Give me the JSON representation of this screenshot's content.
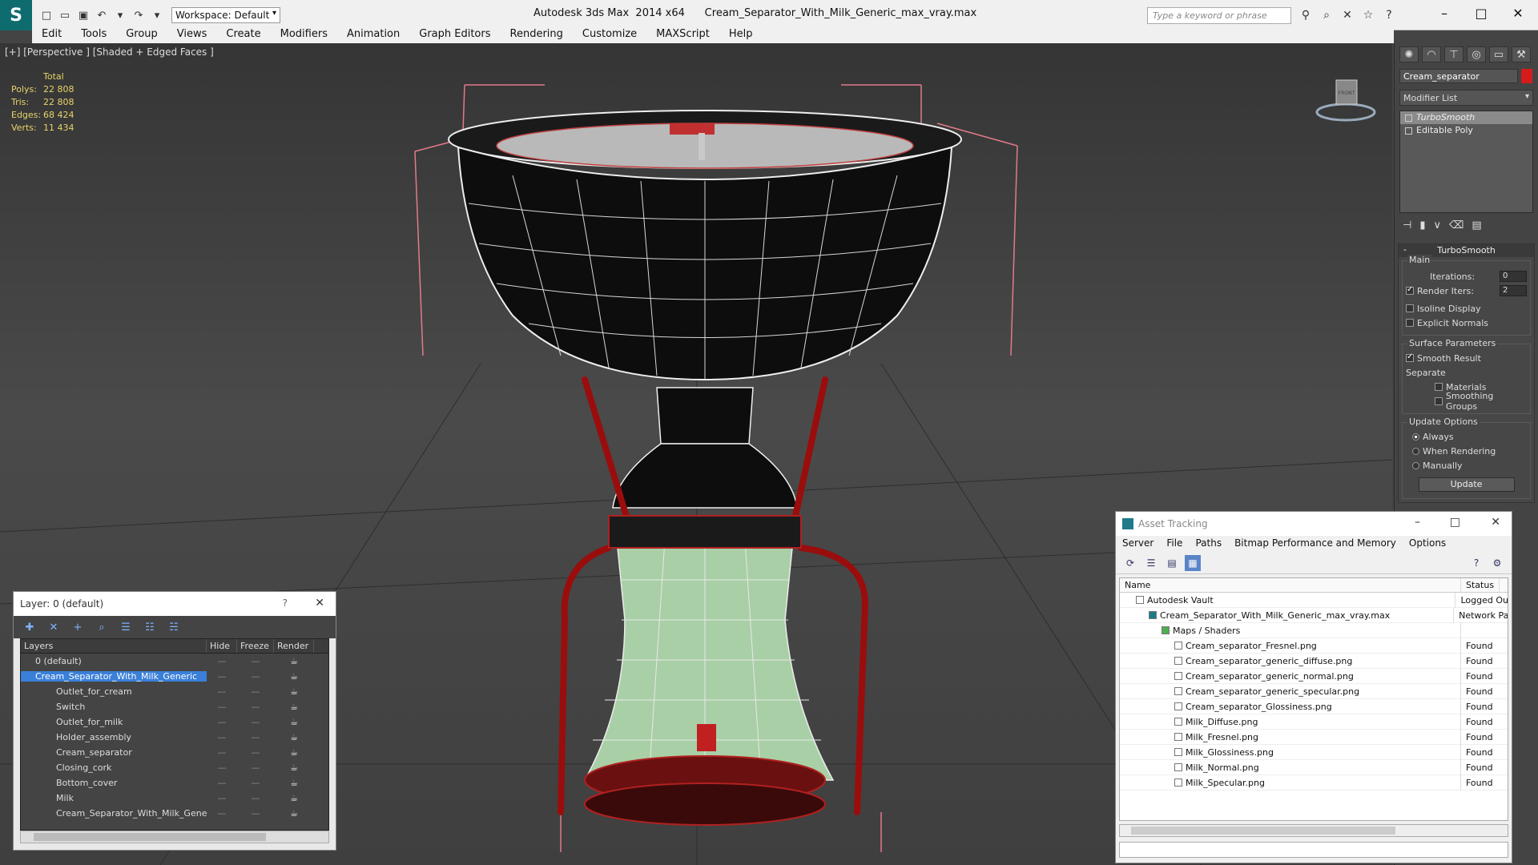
{
  "window": {
    "title": "Autodesk 3ds Max  2014 x64      Cream_Separator_With_Milk_Generic_max_vray.max",
    "workspace": "Workspace: Default",
    "search_placeholder": "Type a keyword or phrase"
  },
  "menu": [
    "Edit",
    "Tools",
    "Group",
    "Views",
    "Create",
    "Modifiers",
    "Animation",
    "Graph Editors",
    "Rendering",
    "Customize",
    "MAXScript",
    "Help"
  ],
  "viewport": {
    "label": "[+] [Perspective ] [Shaded + Edged Faces ]",
    "stats": {
      "header": "Total",
      "rows": [
        {
          "k": "Polys:",
          "v": "22 808"
        },
        {
          "k": "Tris:",
          "v": "22 808"
        },
        {
          "k": "Edges:",
          "v": "68 424"
        },
        {
          "k": "Verts:",
          "v": "11 434"
        }
      ]
    },
    "cube_label": "FRONT"
  },
  "command_panel": {
    "object_name": "Cream_separator",
    "color": "#d41c1c",
    "modifier_list": "Modifier List",
    "stack": [
      "TurboSmooth",
      "Editable Poly"
    ],
    "rollout_title": "TurboSmooth",
    "main_label": "Main",
    "iterations_label": "Iterations:",
    "iterations_value": "0",
    "render_iters_label": "Render Iters:",
    "render_iters_value": "2",
    "isoline": "Isoline Display",
    "explicit": "Explicit Normals",
    "surface_label": "Surface Parameters",
    "smooth_result": "Smooth Result",
    "separate": "Separate",
    "materials": "Materials",
    "smoothing_groups": "Smoothing Groups",
    "update_options": "Update Options",
    "always": "Always",
    "when_rendering": "When Rendering",
    "manually": "Manually",
    "update_btn": "Update"
  },
  "layer_window": {
    "title": "Layer: 0 (default)",
    "help": "?",
    "columns": [
      "Layers",
      "Hide",
      "Freeze",
      "Render"
    ],
    "rows": [
      {
        "name": "0 (default)",
        "level": 0
      },
      {
        "name": "Cream_Separator_With_Milk_Generic",
        "level": 0,
        "selected": true
      },
      {
        "name": "Outlet_for_cream",
        "level": 1
      },
      {
        "name": "Switch",
        "level": 1
      },
      {
        "name": "Outlet_for_milk",
        "level": 1
      },
      {
        "name": "Holder_assembly",
        "level": 1
      },
      {
        "name": "Cream_separator",
        "level": 1
      },
      {
        "name": "Closing_cork",
        "level": 1
      },
      {
        "name": "Bottom_cover",
        "level": 1
      },
      {
        "name": "Milk",
        "level": 1
      },
      {
        "name": "Cream_Separator_With_Milk_Generic",
        "level": 1
      }
    ]
  },
  "asset_window": {
    "title": "Asset Tracking",
    "menu": [
      "Server",
      "File",
      "Paths",
      "Bitmap Performance and Memory",
      "Options"
    ],
    "columns": [
      "Name",
      "Status"
    ],
    "rows": [
      {
        "name": "Autodesk Vault",
        "status": "Logged Ou",
        "indent": 1
      },
      {
        "name": "Cream_Separator_With_Milk_Generic_max_vray.max",
        "status": "Network Pa",
        "indent": 2
      },
      {
        "name": "Maps / Shaders",
        "status": "",
        "indent": 3
      },
      {
        "name": "Cream_separator_Fresnel.png",
        "status": "Found",
        "indent": 4
      },
      {
        "name": "Cream_separator_generic_diffuse.png",
        "status": "Found",
        "indent": 4
      },
      {
        "name": "Cream_separator_generic_normal.png",
        "status": "Found",
        "indent": 4
      },
      {
        "name": "Cream_separator_generic_specular.png",
        "status": "Found",
        "indent": 4
      },
      {
        "name": "Cream_separator_Glossiness.png",
        "status": "Found",
        "indent": 4
      },
      {
        "name": "Milk_Diffuse.png",
        "status": "Found",
        "indent": 4
      },
      {
        "name": "Milk_Fresnel.png",
        "status": "Found",
        "indent": 4
      },
      {
        "name": "Milk_Glossiness.png",
        "status": "Found",
        "indent": 4
      },
      {
        "name": "Milk_Normal.png",
        "status": "Found",
        "indent": 4
      },
      {
        "name": "Milk_Specular.png",
        "status": "Found",
        "indent": 4
      }
    ]
  }
}
